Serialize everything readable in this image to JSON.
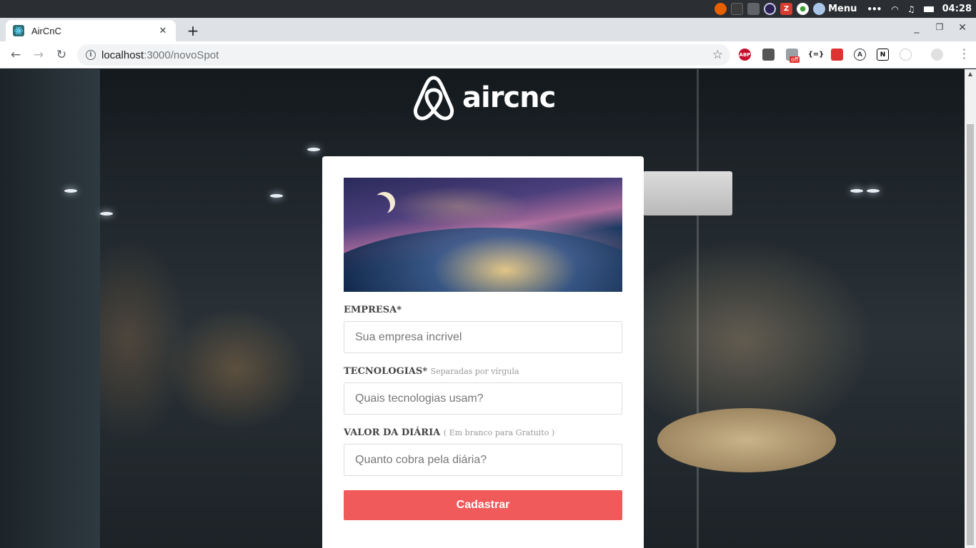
{
  "system": {
    "menu_label": "Menu",
    "clock": "04:28",
    "tray_icons": [
      "firefox-icon",
      "terminal-icon",
      "folder-icon",
      "eclipse-icon",
      "zeal-icon",
      "mongodb-icon",
      "avatar-icon",
      "ellipsis-icon",
      "wifi-icon",
      "music-icon",
      "battery-icon"
    ]
  },
  "browser": {
    "tab_title": "AirCnC",
    "url_host": "localhost",
    "url_rest": ":3000/novoSpot",
    "extensions": [
      "abp-icon",
      "extension-icon",
      "extension-off-icon",
      "json-viewer-icon",
      "extension-icon",
      "extension-icon",
      "notion-icon",
      "extension-icon"
    ],
    "abp_label": "ABP",
    "off_badge": "off",
    "json_label": "{=}",
    "a_label": "A",
    "n_label": "N"
  },
  "page": {
    "logo_text": "aircnc",
    "form": {
      "empresa_label": "EMPRESA*",
      "empresa_placeholder": "Sua empresa incrivel",
      "tecnologias_label": "TECNOLOGIAS*",
      "tecnologias_hint": "Separadas por vírgula",
      "tecnologias_placeholder": "Quais tecnologias usam?",
      "valor_label": "VALOR DA DIÁRIA",
      "valor_hint": "( Em branco para Gratuito )",
      "valor_placeholder": "Quanto cobra pela diária?",
      "submit_label": "Cadastrar"
    }
  },
  "colors": {
    "accent": "#f05a5b",
    "system_bar": "#2b2e33",
    "tabstrip": "#dee1e6"
  }
}
